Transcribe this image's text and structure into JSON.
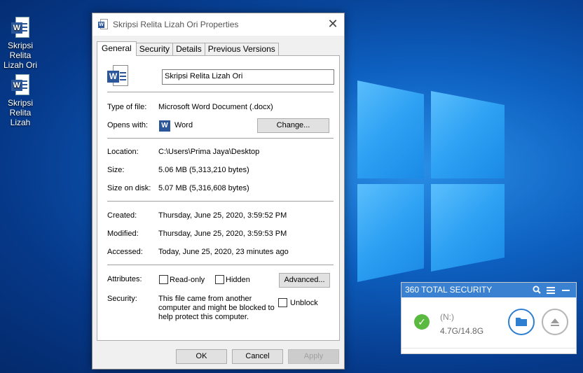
{
  "desktop": {
    "icons": [
      {
        "label_line1": "Skripsi Relita",
        "label_line2": "Lizah Ori"
      },
      {
        "label_line1": "Skripsi Relita",
        "label_line2": "Lizah"
      }
    ]
  },
  "dialog": {
    "title": "Skripsi Relita Lizah Ori Properties",
    "tabs": [
      "General",
      "Security",
      "Details",
      "Previous Versions"
    ],
    "file_name": "Skripsi Relita Lizah Ori",
    "type_label": "Type of file:",
    "type_value": "Microsoft Word Document (.docx)",
    "opens_label": "Opens with:",
    "opens_value": "Word",
    "change_button": "Change...",
    "location_label": "Location:",
    "location_value": "C:\\Users\\Prima Jaya\\Desktop",
    "size_label": "Size:",
    "size_value": "5.06 MB (5,313,210 bytes)",
    "size_on_disk_label": "Size on disk:",
    "size_on_disk_value": "5.07 MB (5,316,608 bytes)",
    "created_label": "Created:",
    "created_value": "Thursday, June 25, 2020, 3:59:52 PM",
    "modified_label": "Modified:",
    "modified_value": "Thursday, June 25, 2020, 3:59:53 PM",
    "accessed_label": "Accessed:",
    "accessed_value": "Today, June 25, 2020, 23 minutes ago",
    "attributes_label": "Attributes:",
    "readonly_label": "Read-only",
    "hidden_label": "Hidden",
    "advanced_button": "Advanced...",
    "security_label": "Security:",
    "security_text_1": "This file came from another",
    "security_text_2": "computer and might be blocked to",
    "security_text_3": "help protect this computer.",
    "unblock_label": "Unblock",
    "ok_button": "OK",
    "cancel_button": "Cancel",
    "apply_button": "Apply"
  },
  "widget360": {
    "title": "360 TOTAL SECURITY",
    "drive_label": "(N:)",
    "drive_usage": "4.7G/14.8G",
    "colors": {
      "header": "#3a81d2",
      "ok": "#5aba3f",
      "accent": "#2e7fd1"
    }
  }
}
